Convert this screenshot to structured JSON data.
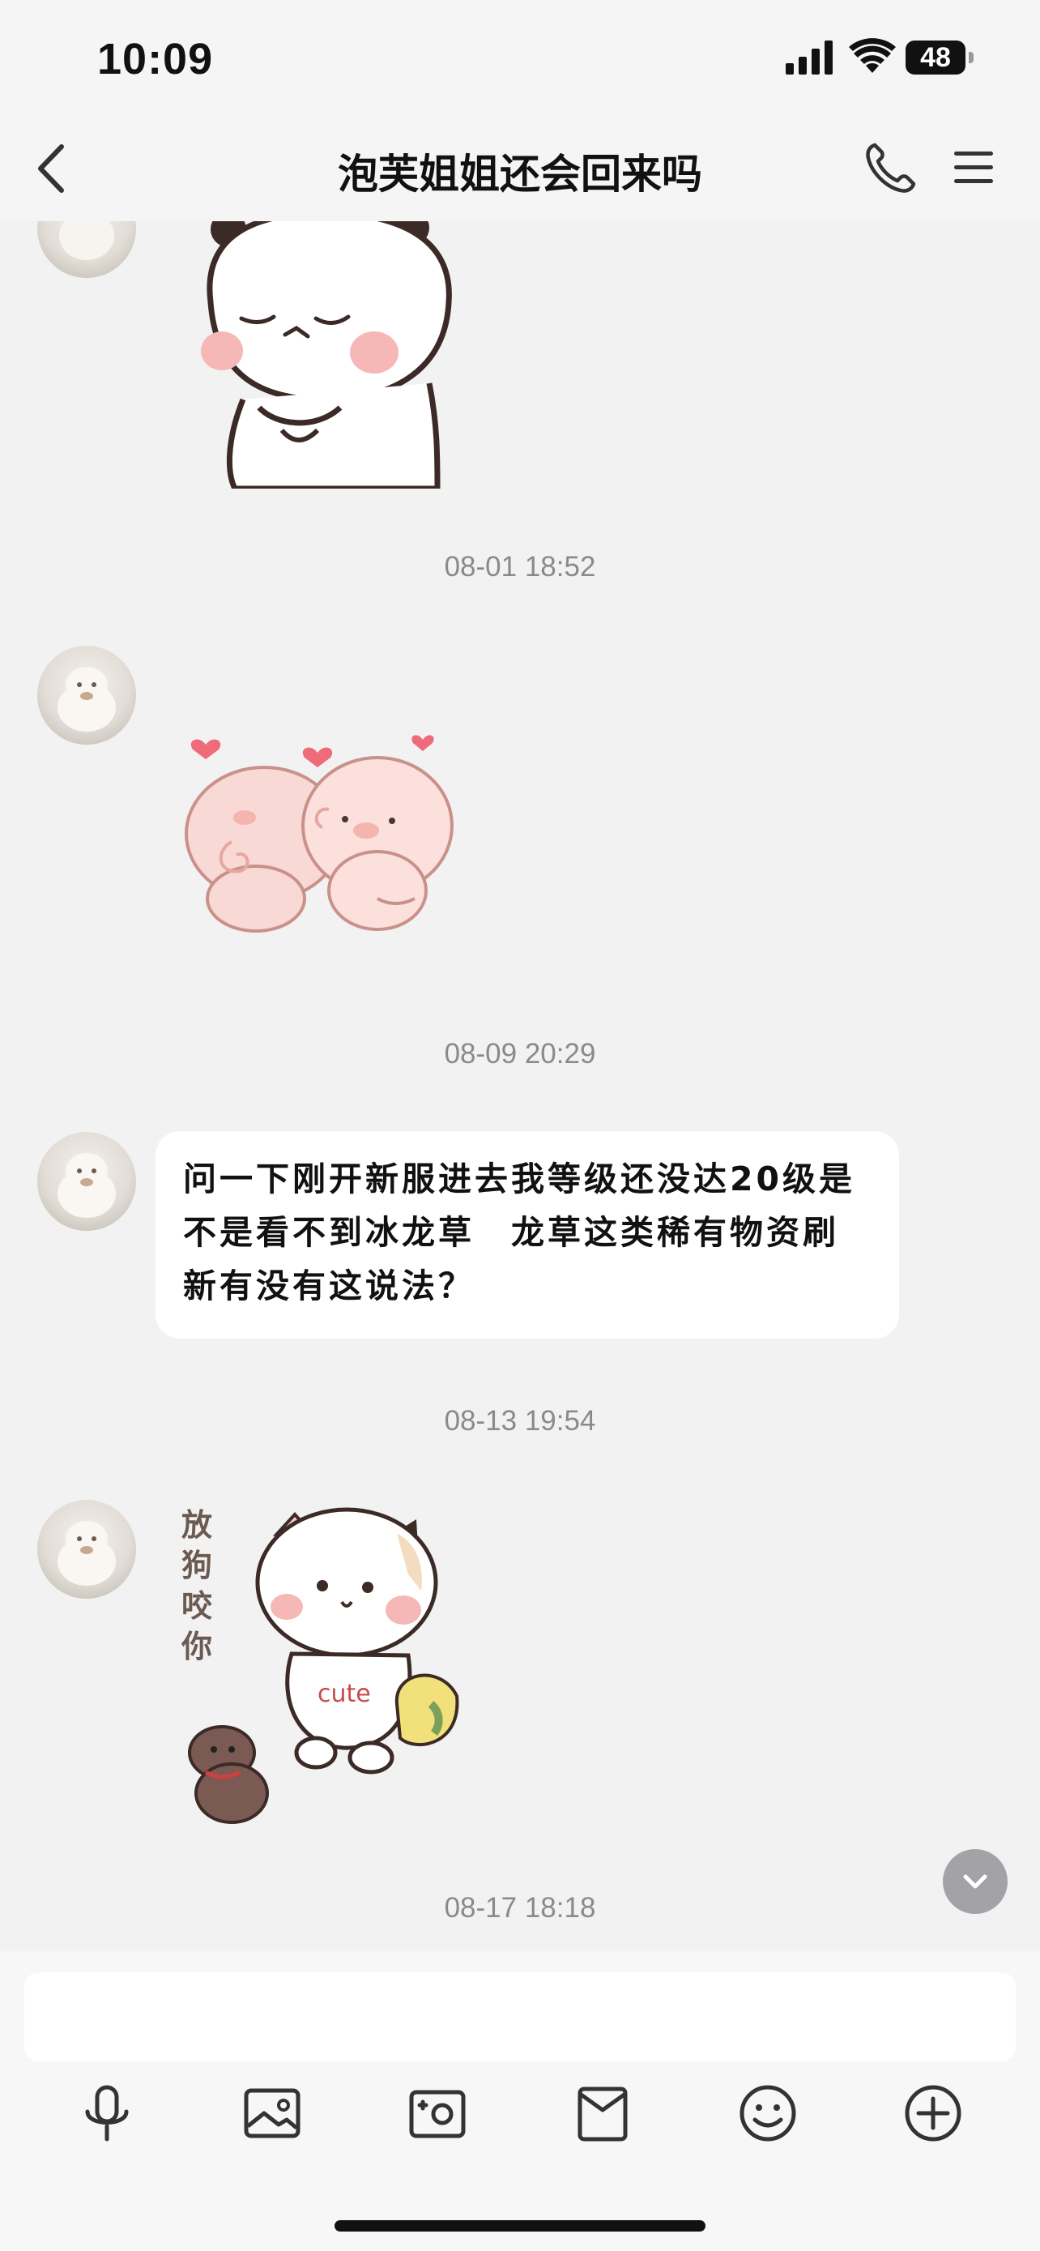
{
  "status_bar": {
    "time": "10:09",
    "battery": "48"
  },
  "nav": {
    "title": "泡芙姐姐还会回来吗",
    "back_icon": "chevron-left-icon",
    "call_icon": "phone-icon",
    "menu_icon": "menu-icon"
  },
  "messages": [
    {
      "timestamp": "08-01 18:52",
      "type": "sticker",
      "sticker": "pigs-hearts-sticker"
    },
    {
      "timestamp": "08-09 20:29",
      "type": "text",
      "text": "问一下刚开新服进去我等级还没达20级是不是看不到冰龙草　龙草这类稀有物资刷新有没有这说法？"
    },
    {
      "timestamp": "08-13 19:54",
      "type": "sticker",
      "sticker": "cat-dog-sticker",
      "sticker_caption": "放狗咬你",
      "shirt_text": "cute"
    },
    {
      "timestamp": "08-17 18:18"
    }
  ],
  "toolbar": {
    "items": [
      "mic-icon",
      "image-icon",
      "camera-icon",
      "envelope-icon",
      "emoji-icon",
      "plus-icon"
    ]
  },
  "colors": {
    "background": "#f2f2f3",
    "bubble": "#ffffff",
    "timestamp": "#8a8a8e"
  }
}
